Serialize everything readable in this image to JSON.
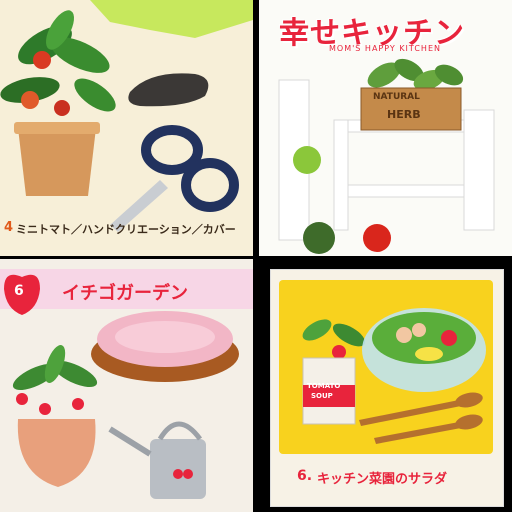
{
  "panel_top_left": {
    "item_number": "4",
    "caption": "ミニトマト／ハンドクリエーション／カバー"
  },
  "panel_top_right": {
    "title": "幸せキッチン",
    "subtitle": "MOM'S HAPPY KITCHEN",
    "box_label_line1": "NATURAL",
    "box_label_line2": "HERB"
  },
  "panel_bottom_left": {
    "item_number": "6",
    "title": "イチゴガーデン"
  },
  "panel_bottom_right": {
    "can_label_line1": "TOMATO",
    "can_label_line2": "SOUP",
    "caption_number": "6.",
    "caption": "キッチン菜園のサラダ"
  },
  "colors": {
    "green_banner": "#c7e85d",
    "title_red": "#e8243c",
    "pink_banner": "#f7d6e6",
    "yellow_bg": "#f8d21e"
  }
}
